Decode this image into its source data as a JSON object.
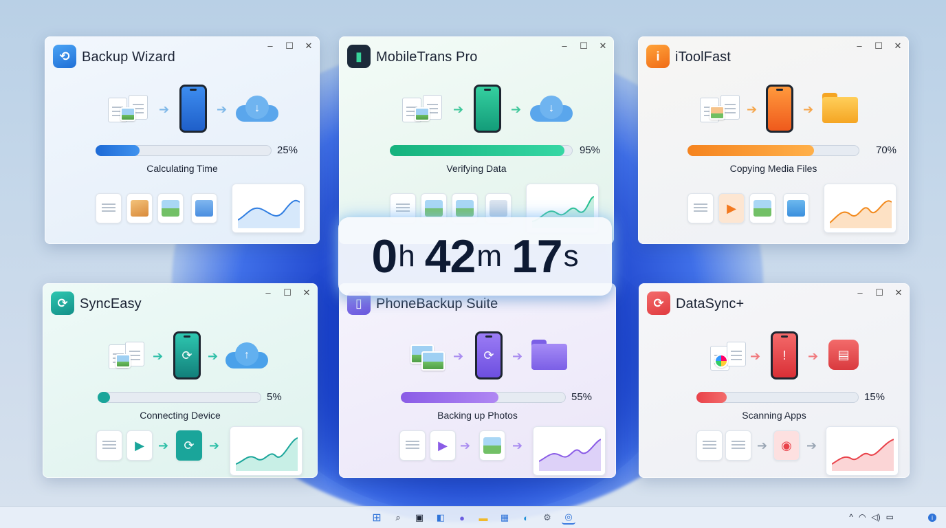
{
  "windows": [
    {
      "title": "Backup Wizard",
      "percent": "25%",
      "progress": 0.25,
      "status": "Calculating Time",
      "accent": "#2f7de1"
    },
    {
      "title": "MobileTrans Pro",
      "percent": "95%",
      "progress": 0.95,
      "status": "Verifying Data",
      "accent": "#1fbf8a"
    },
    {
      "title": "iToolFast",
      "percent": "70%",
      "progress": 0.7,
      "status": "Copying Media Files",
      "accent": "#f28a1e"
    },
    {
      "title": "SyncEasy",
      "percent": "5%",
      "progress": 0.05,
      "status": "Connecting Device",
      "accent": "#1aa59a"
    },
    {
      "title": "PhoneBackup Suite",
      "percent": "55%",
      "progress": 0.55,
      "status": "Backing up Photos",
      "accent": "#8a5ce6"
    },
    {
      "title": "DataSync+",
      "percent": "15%",
      "progress": 0.15,
      "status": "Scanning Apps",
      "accent": "#e9424a"
    }
  ],
  "window_controls": {
    "minimize": "–",
    "maximize": "☐",
    "close": "✕"
  },
  "timer": {
    "hours": "0",
    "hours_unit": "h",
    "minutes": "42",
    "minutes_unit": "m",
    "seconds": "17",
    "seconds_unit": "s"
  },
  "taskbar": {
    "icons": [
      "start-icon",
      "search-icon",
      "task-view-icon",
      "widgets-icon",
      "chat-icon",
      "file-explorer-icon",
      "store-icon",
      "edge-icon",
      "settings-icon",
      "backup-app-icon"
    ],
    "tray": {
      "chevron": "^",
      "network": "wifi-icon",
      "volume": "speaker-icon",
      "battery": "battery-icon",
      "notification": "i"
    }
  }
}
